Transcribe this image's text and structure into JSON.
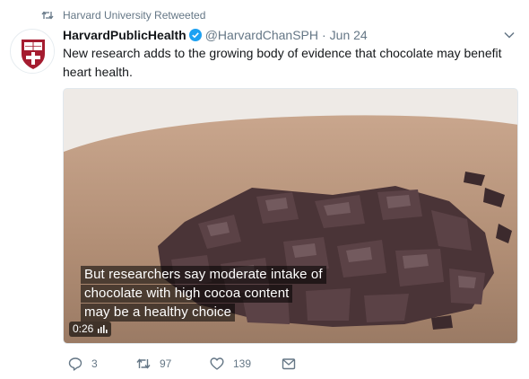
{
  "retweet_context": {
    "text": "Harvard University Retweeted",
    "icon": "retweet-icon"
  },
  "author": {
    "name": "HarvardPublicHealth",
    "verified_icon": "verified-badge-icon",
    "handle": "@HarvardChanSPH",
    "separator": "·",
    "date": "Jun 24",
    "avatar_icon": "harvard-shield-logo"
  },
  "menu_icon": "chevron-down-icon",
  "tweet": {
    "text": "New research adds to the growing body of evidence that chocolate may benefit heart health."
  },
  "media": {
    "subtitle_lines": [
      "But researchers say moderate intake of",
      "chocolate with high cocoa content",
      "may be a healthy choice"
    ],
    "duration": "0:26",
    "volume_icon": "volume-bars-icon"
  },
  "actions": {
    "reply": {
      "icon": "reply-icon",
      "count": "3"
    },
    "retweet": {
      "icon": "retweet-icon",
      "count": "97"
    },
    "like": {
      "icon": "heart-icon",
      "count": "139"
    },
    "dm": {
      "icon": "envelope-icon"
    }
  },
  "colors": {
    "secondary_text": "#657786",
    "verified_blue": "#1da1f2",
    "harvard_crimson": "#a51c30"
  }
}
